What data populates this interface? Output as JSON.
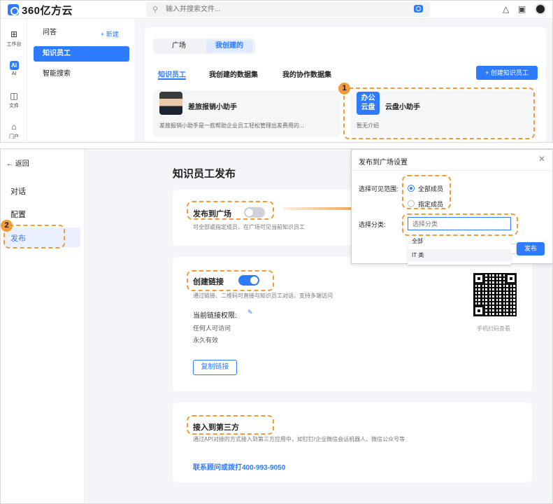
{
  "top": {
    "brand": "360亿方云",
    "search_placeholder": "输入并搜索文件...",
    "rail": [
      {
        "label": "工作台",
        "icon": "grid-icon"
      },
      {
        "label": "AI",
        "icon": "ai-icon"
      },
      {
        "label": "文件",
        "icon": "folder-icon"
      },
      {
        "label": "门户",
        "icon": "portal-icon"
      }
    ],
    "side": {
      "section": "问答",
      "new_label": "+ 新建",
      "items": [
        "知识员工",
        "智能搜索"
      ]
    },
    "segments": [
      "广场",
      "我创建的"
    ],
    "tabs": [
      "知识员工",
      "我创建的数据集",
      "我的协作数据集"
    ],
    "create_button": "+ 创建知识员工",
    "cards": [
      {
        "title": "差旅报销小助手",
        "desc": "差旅报销小助手是一款帮助企业员工轻松管理出差费用的...",
        "avatar_text": ""
      },
      {
        "title": "云盘小助手",
        "desc": "暂无介绍",
        "avatar_text": "办公\n云盘"
      }
    ],
    "badge": "1"
  },
  "bottom": {
    "back_label": "返回",
    "nav": [
      "对话",
      "配置",
      "发布"
    ],
    "badge": "2",
    "page_title": "知识员工发布",
    "publish": {
      "title": "发布到广场",
      "desc": "可全部或指定成员，在广场可见当前知识员工",
      "enabled": false
    },
    "link": {
      "title": "创建链接",
      "desc": "通过链接、二维码可直接与知识员工对话，支持多端访问",
      "enabled": true,
      "perm_label": "当前链接权限:",
      "perm_values": [
        "任何人可访问",
        "永久有效"
      ],
      "copy_button": "复制链接",
      "scan_text": "手机扫码查看"
    },
    "third_party": {
      "title": "接入到第三方",
      "desc": "通过API对接的方式接入到第三方应用中，如钉钉/企业微信会话机器人、微信公众号等",
      "contact": "联系顾问或拨打400-993-9050"
    },
    "dialog": {
      "title": "发布到广场设置",
      "scope_label": "选择可见范围:",
      "scope_options": [
        "全部成员",
        "指定成员"
      ],
      "selected_scope": "全部成员",
      "category_label": "选择分类:",
      "category_placeholder": "选择分类",
      "category_options": [
        "全部",
        "IT 类"
      ],
      "publish_button": "发布"
    },
    "colors": {
      "accent": "#2f7bff",
      "highlight": "#f39a3a"
    }
  }
}
